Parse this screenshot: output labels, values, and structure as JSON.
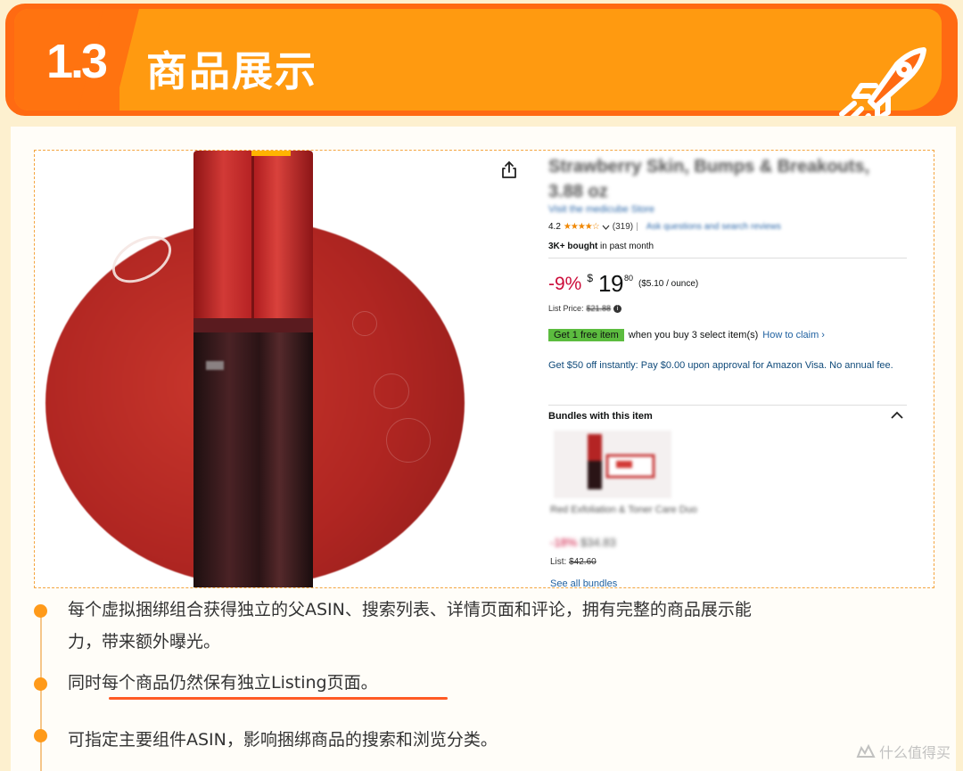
{
  "header": {
    "section_number": "1.3",
    "title": "商品展示"
  },
  "product": {
    "title_blurred": "Strawberry Skin, Bumps & Breakouts, 3.88 oz",
    "store_blurred": "Visit the medicube Store",
    "rating_value": "4.2",
    "stars": "★★★★☆",
    "rating_count": "(319)",
    "rating_link_blurred": "Ask questions and search reviews",
    "bought_strong": "3K+ bought",
    "bought_rest": " in past month",
    "discount": "-9%",
    "price_symbol": "$",
    "price_whole": "19",
    "price_fraction": "80",
    "unit_price": "($5.10 / ounce)",
    "list_price_label": "List Price:",
    "list_price": "$21.88",
    "promo_badge": "Get 1 free item",
    "promo_text": "when you buy 3 select item(s)",
    "promo_link": "How to claim ›",
    "visa_offer": "Get $50 off instantly: Pay $0.00 upon approval for Amazon Visa. No annual fee.",
    "bundles_title": "Bundles with this item",
    "bundle_name_blurred": "Red Exfoliation & Toner Care Duo",
    "bundle_discount_blurred": "-18%",
    "bundle_price_blurred": "$34.83",
    "bundle_list_label": "List:",
    "bundle_list_price": "$42.60",
    "see_all": "See all bundles"
  },
  "bullets": [
    {
      "line1": "每个虚拟捆绑组合获得独立的父ASIN、搜索列表、详情页面和评论，拥有完整的商品展示能",
      "line2": "力，带来额外曝光。"
    },
    {
      "line1": "同时每个商品仍然保有独立Listing页面。"
    },
    {
      "line1": "可指定主要组件ASIN，影响捆绑商品的搜索和浏览分类。"
    }
  ],
  "watermark": "什么值得买",
  "colors": {
    "banner_outer": "#ff6a12",
    "banner_inner": "#ff9a10",
    "bullet": "#ff9a1a",
    "discount_red": "#cc0c39",
    "promo_green": "#5cbc3f"
  }
}
